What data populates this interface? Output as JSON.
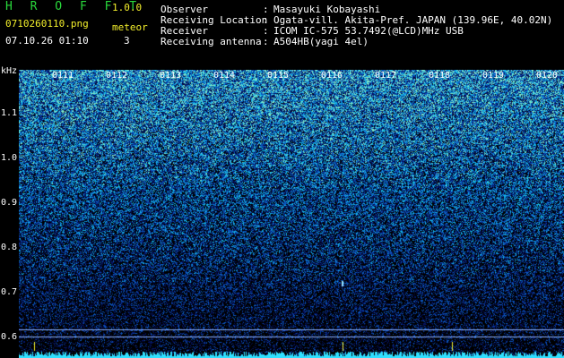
{
  "header": {
    "app_title": "H R O F F T",
    "version": "1.0.0",
    "filename": "0710260110.png",
    "mode_label": "meteor",
    "datetime": "07.10.26 01:10",
    "mode_value": "3",
    "meta": [
      {
        "label": "Observer",
        "value": "Masayuki Kobayashi"
      },
      {
        "label": "Receiving Location",
        "value": "Ogata-vill. Akita-Pref. JAPAN (139.96E, 40.02N)"
      },
      {
        "label": "Receiver",
        "value": "ICOM IC-575 53.7492(@LCD)MHz USB"
      },
      {
        "label": "Receiving antenna",
        "value": "A504HB(yagi 4el)"
      }
    ]
  },
  "axis": {
    "unit": "kHz",
    "y_ticks": [
      "1.1",
      "1.0",
      "0.9",
      "0.8",
      "0.7",
      "0.6"
    ],
    "x_ticks": [
      "0111",
      "0112",
      "0113",
      "0114",
      "0115",
      "0116",
      "0117",
      "0118",
      "0119",
      "0120"
    ]
  },
  "colors": {
    "title_green": "#29d93c",
    "label_yellow": "#f4f02c",
    "noise_deep": "#0a1a80",
    "noise_high": "#30d0e0"
  }
}
